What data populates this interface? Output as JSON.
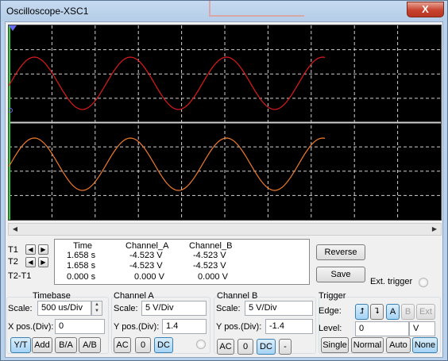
{
  "window": {
    "title": "Oscilloscope-XSC1",
    "close_glyph": "X"
  },
  "icons": {
    "left": "arrow-left-icon",
    "right": "arrow-right-icon",
    "rising_edge": "rising-edge-icon",
    "falling_edge": "falling-edge-icon",
    "scroll_left": "scroll-left-icon",
    "scroll_right": "scroll-right-icon"
  },
  "colors": {
    "screen_bg": "#000000",
    "grid": "#d0d0d0",
    "channel_a_trace": "#e01a1a",
    "channel_b_trace": "#f07a2a",
    "selected_btn": "#a5d3f5"
  },
  "glyphs": {
    "arrow_left": "◀",
    "arrow_right": "▶",
    "rising": "⮥",
    "falling": "⮧",
    "spin_up": "▲",
    "spin_down": "▼"
  },
  "readout": {
    "headers": {
      "time": "Time",
      "channel_a": "Channel_A",
      "channel_b": "Channel_B"
    },
    "rows": [
      {
        "label": "T1",
        "time": "1.658 s",
        "a": "-4.523 V",
        "b": "-4.523 V"
      },
      {
        "label": "T2",
        "time": "1.658 s",
        "a": "-4.523 V",
        "b": "-4.523 V"
      },
      {
        "label": "T2-T1",
        "time": "0.000 s",
        "a": "0.000 V",
        "b": "0.000 V"
      }
    ]
  },
  "buttons": {
    "reverse": "Reverse",
    "save": "Save",
    "ext_trigger": "Ext. trigger"
  },
  "timebase": {
    "title": "Timebase",
    "scale_label": "Scale:",
    "scale_value": "500 us/Div",
    "xpos_label": "X pos.(Div):",
    "xpos_value": "0",
    "modes": [
      "Y/T",
      "Add",
      "B/A",
      "A/B"
    ]
  },
  "channel_a": {
    "title": "Channel A",
    "scale_label": "Scale:",
    "scale_value": "5  V/Div",
    "ypos_label": "Y pos.(Div):",
    "ypos_value": "1.4",
    "coupling": [
      "AC",
      "0",
      "DC"
    ]
  },
  "channel_b": {
    "title": "Channel B",
    "scale_label": "Scale:",
    "scale_value": "5  V/Div",
    "ypos_label": "Y pos.(Div):",
    "ypos_value": "-1.4",
    "coupling": [
      "AC",
      "0",
      "DC",
      "-"
    ]
  },
  "trigger": {
    "title": "Trigger",
    "edge_label": "Edge:",
    "sources": [
      "A",
      "B",
      "Ext"
    ],
    "level_label": "Level:",
    "level_value": "0",
    "level_unit": "V",
    "modes": [
      "Single",
      "Normal",
      "Auto",
      "None"
    ]
  }
}
